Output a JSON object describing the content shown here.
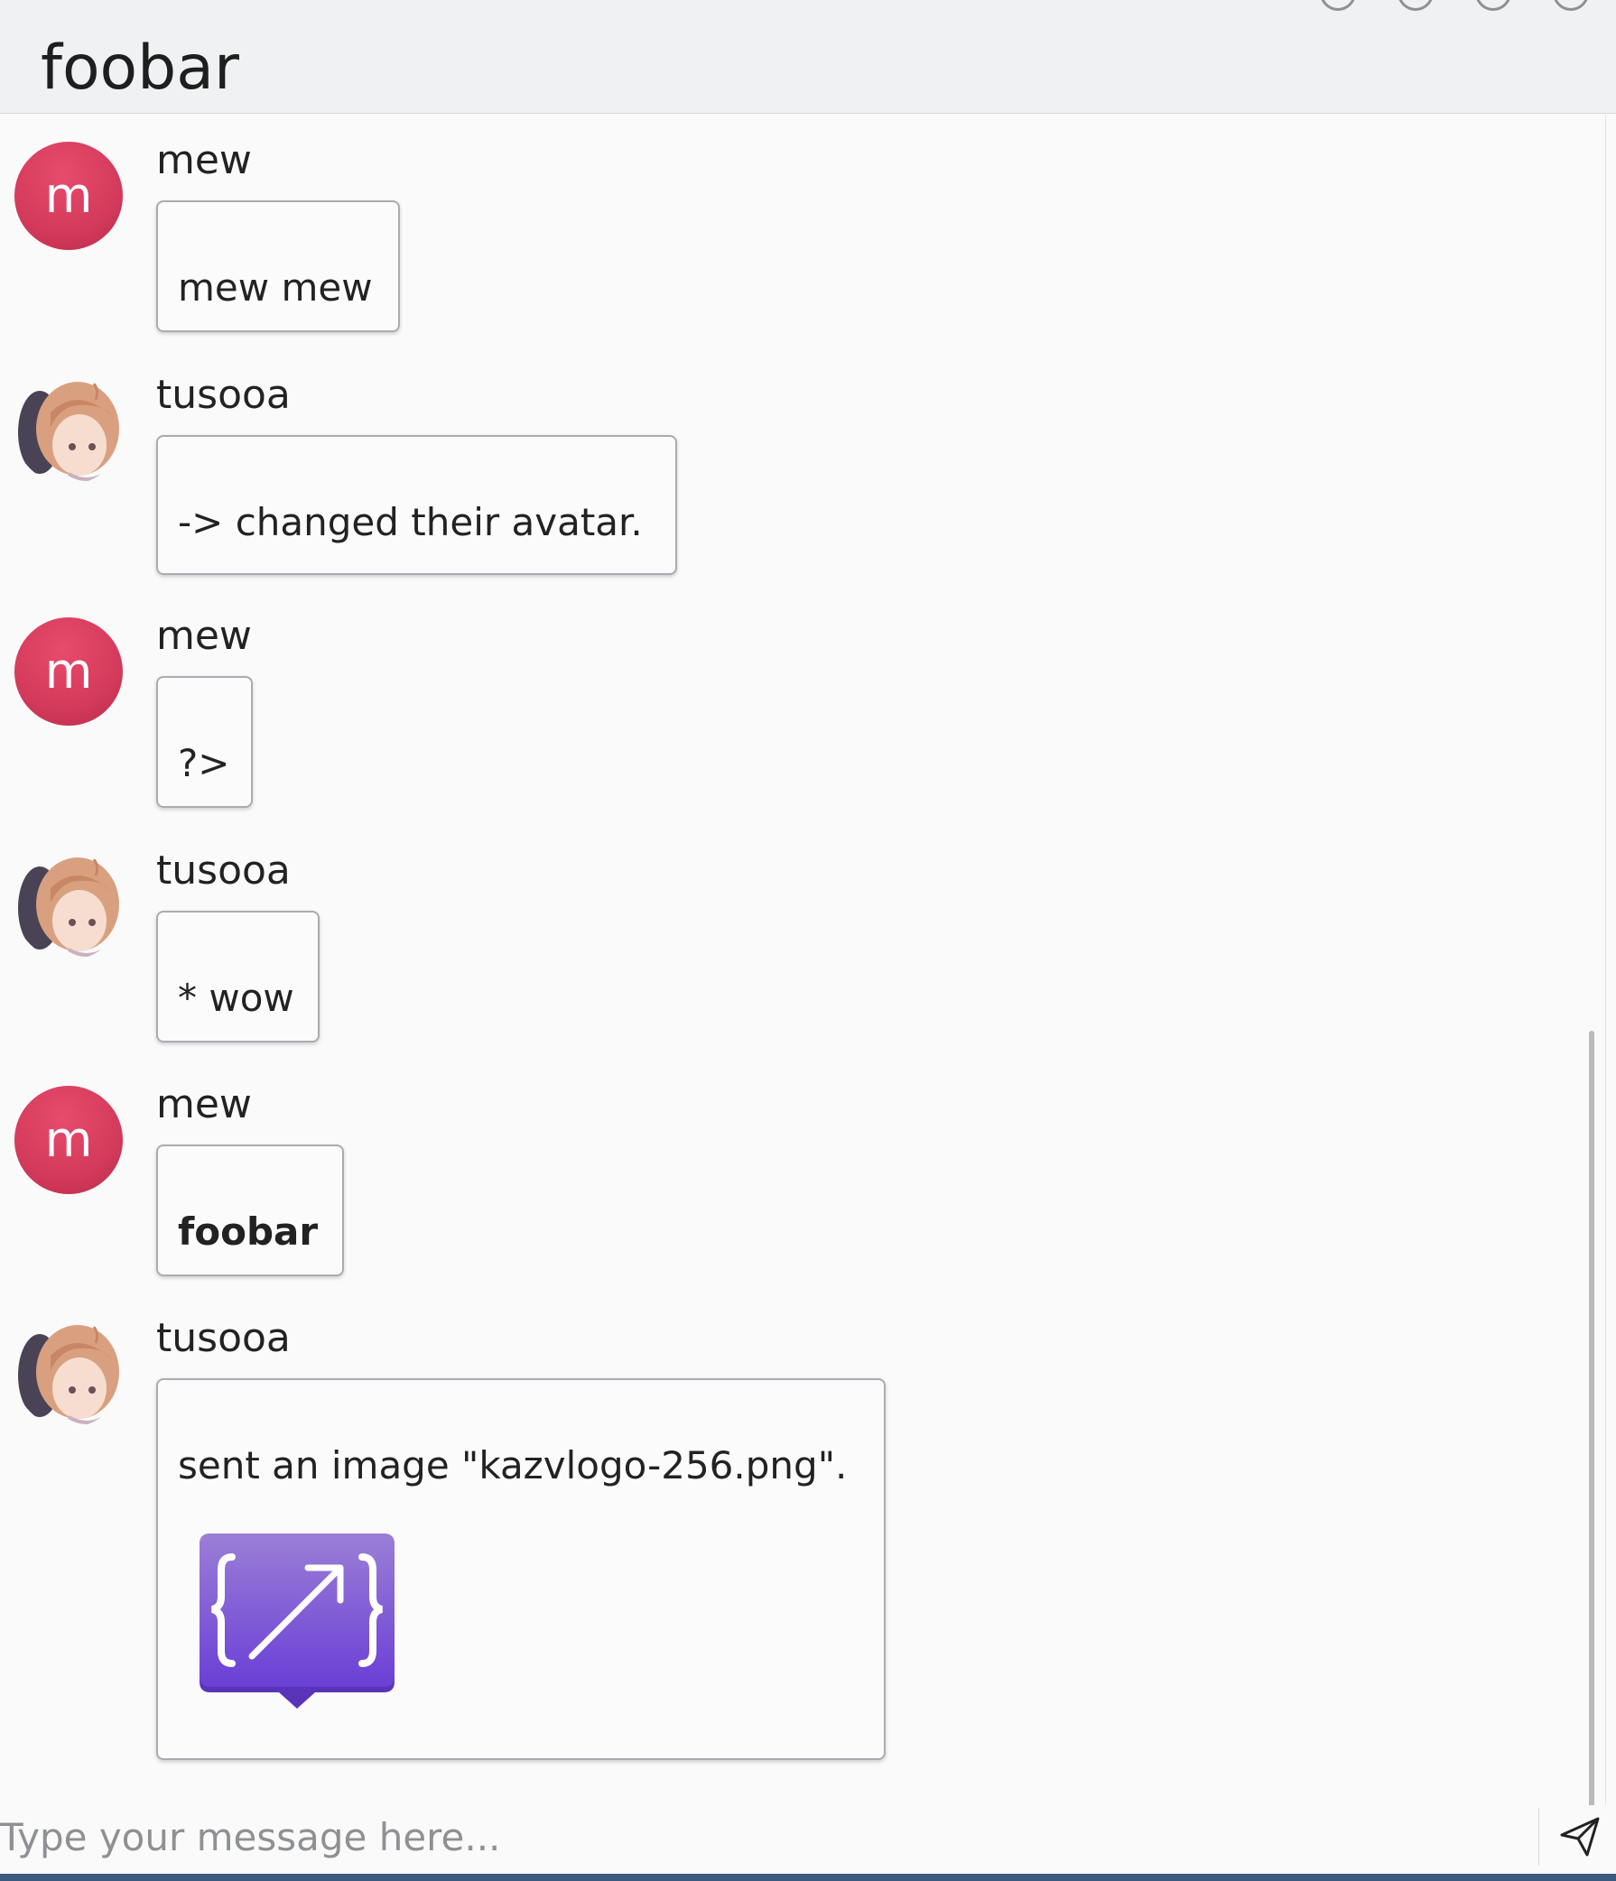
{
  "room": {
    "title": "foobar"
  },
  "messages": [
    {
      "sender": "mew",
      "avatar_letter": "m",
      "text": "mew mew"
    },
    {
      "sender": "tusooa",
      "text": "-> changed their avatar."
    },
    {
      "sender": "mew",
      "avatar_letter": "m",
      "text": "?>"
    },
    {
      "sender": "tusooa",
      "text": "* wow"
    },
    {
      "sender": "mew",
      "avatar_letter": "m",
      "text": "foobar"
    },
    {
      "sender": "tusooa",
      "text": "sent an image \"kazvlogo-256.png\"."
    }
  ],
  "composer": {
    "placeholder": "Type your message here..."
  },
  "icons": {
    "send": "send-paper-plane-icon",
    "image": "kazv-logo-image"
  },
  "colors": {
    "avatar_red": "#d43a5b",
    "logo_purple": "#7a4fd8",
    "bottom_bar": "#3b5a7d"
  }
}
